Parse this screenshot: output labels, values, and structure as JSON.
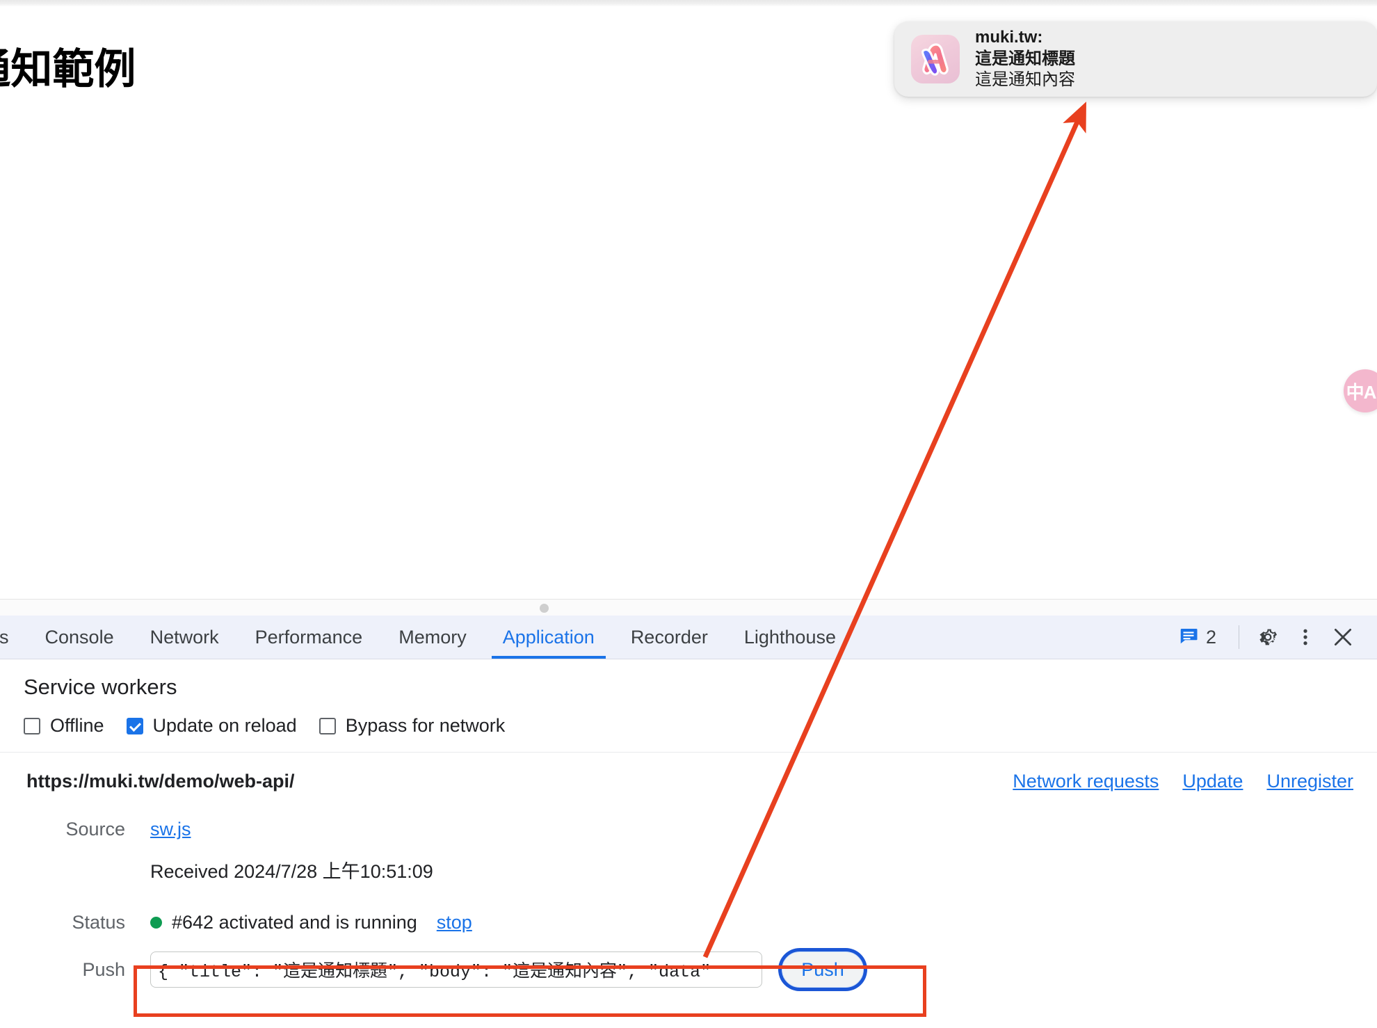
{
  "page": {
    "title": "er 通知範例"
  },
  "notification": {
    "app": "muki.tw:",
    "title": "這是通知標題",
    "body": "這是通知內容",
    "icon": "app-logo-icon"
  },
  "translate_widget": {
    "glyph": "中A",
    "icon": "translate-icon",
    "color": "#f3b7cd"
  },
  "devtools": {
    "tabs": [
      {
        "label": "es",
        "active": false
      },
      {
        "label": "Console",
        "active": false
      },
      {
        "label": "Network",
        "active": false
      },
      {
        "label": "Performance",
        "active": false
      },
      {
        "label": "Memory",
        "active": false
      },
      {
        "label": "Application",
        "active": true
      },
      {
        "label": "Recorder",
        "active": false
      },
      {
        "label": "Lighthouse",
        "active": false
      }
    ],
    "active_tab_color": "#1a73e8",
    "message_count": "2",
    "icons": {
      "messages": "message-icon",
      "settings": "gear-icon",
      "more": "more-vertical-icon",
      "close": "close-icon"
    }
  },
  "service_workers": {
    "heading": "Service workers",
    "options": [
      {
        "label": "Offline",
        "checked": false
      },
      {
        "label": "Update on reload",
        "checked": true
      },
      {
        "label": "Bypass for network",
        "checked": false
      }
    ],
    "origin": "https://muki.tw/demo/web-api/",
    "actions": [
      {
        "label": "Network requests"
      },
      {
        "label": "Update"
      },
      {
        "label": "Unregister"
      }
    ],
    "rows": {
      "source_label": "Source",
      "source_value": "sw.js",
      "received": "Received 2024/7/28 上午10:51:09",
      "status_label": "Status",
      "status_value": "#642 activated and is running",
      "status_color": "#0e9c52",
      "stop_label": "stop",
      "push_label": "Push",
      "push_value": "{   \"title\": \"這是通知標題\",   \"body\": \"這是通知內容\",   \"data\"",
      "push_button": "Push"
    }
  },
  "annotation": {
    "color": "#e8401f",
    "highlight_target": "push-row"
  }
}
